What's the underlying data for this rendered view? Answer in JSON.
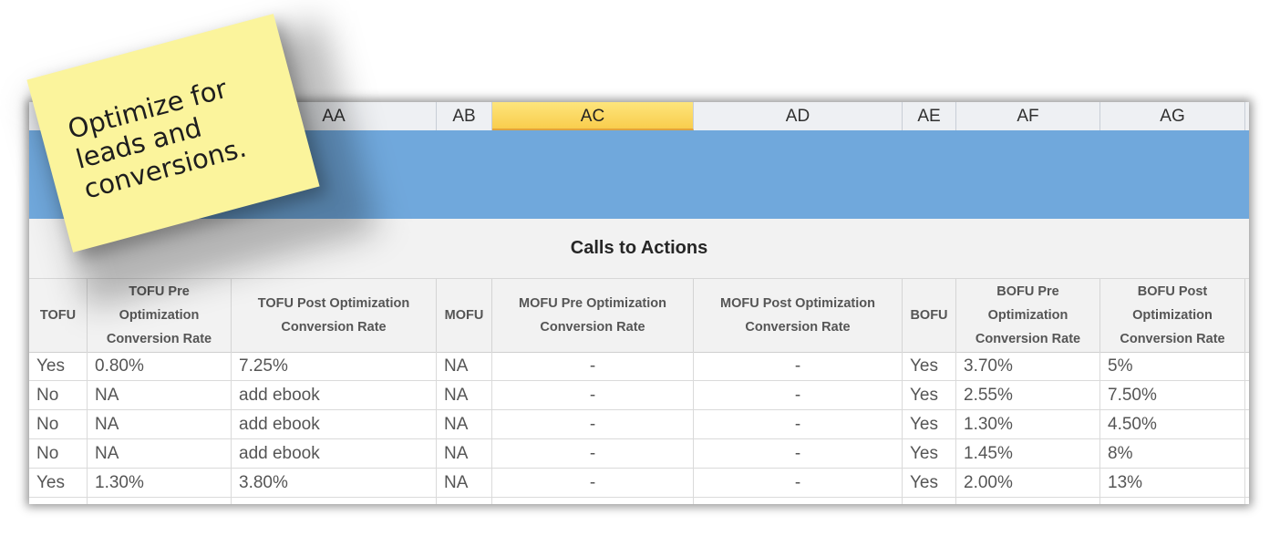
{
  "column_letters": [
    "AA",
    "AB",
    "AC",
    "AD",
    "AE",
    "AF",
    "AG"
  ],
  "active_column": "AC",
  "section_title": "Calls to Actions",
  "headers": [
    "TOFU",
    "TOFU Pre Optimization Conversion Rate",
    "TOFU Post Optimization Conversion Rate",
    "MOFU",
    "MOFU Pre Optimization Conversion Rate",
    "MOFU Post Optimization Conversion Rate",
    "BOFU",
    "BOFU Pre Optimization Conversion Rate",
    "BOFU Post Optimization Conversion Rate"
  ],
  "rows": [
    [
      "Yes",
      "0.80%",
      "7.25%",
      "NA",
      "-",
      "-",
      "Yes",
      "3.70%",
      "5%"
    ],
    [
      "No",
      "NA",
      "add ebook",
      "NA",
      "-",
      "-",
      "Yes",
      "2.55%",
      "7.50%"
    ],
    [
      "No",
      "NA",
      "add ebook",
      "NA",
      "-",
      "-",
      "Yes",
      "1.30%",
      "4.50%"
    ],
    [
      "No",
      "NA",
      "add ebook",
      "NA",
      "-",
      "-",
      "Yes",
      "1.45%",
      "8%"
    ],
    [
      "Yes",
      "1.30%",
      "3.80%",
      "NA",
      "-",
      "-",
      "Yes",
      "2.00%",
      "13%"
    ]
  ],
  "sticky_note": {
    "text": "Optimize for\nleads and\nconversions.",
    "color": "#fbf49c"
  },
  "colors": {
    "header_band": "#70a8dc",
    "active_column": "#f9cd4d"
  }
}
